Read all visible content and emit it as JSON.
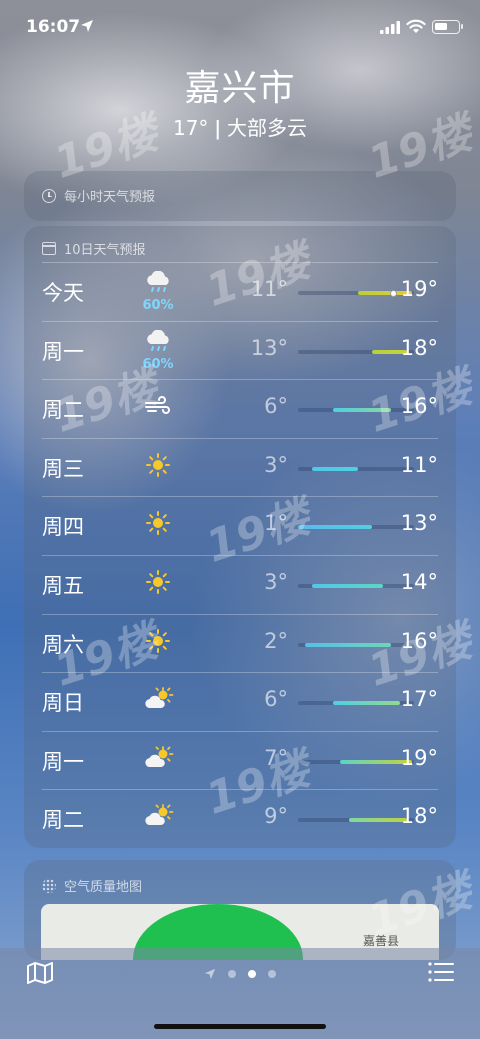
{
  "status_bar": {
    "time": "16:07"
  },
  "header": {
    "city": "嘉兴市",
    "summary": "17° ǀ 大部多云"
  },
  "hourly": {
    "title": "每小时天气预报"
  },
  "daily": {
    "title": "10日天气预报",
    "days": [
      {
        "day": "今天",
        "icon": "rain-cloud-icon",
        "precip": "60%",
        "lo": "11°",
        "hi": "19°",
        "range": [
          0.52,
          0.98
        ],
        "current": 0.82,
        "colors": [
          "#b8cf3a",
          "#e7c93a"
        ]
      },
      {
        "day": "周一",
        "icon": "rain-cloud-icon",
        "precip": "60%",
        "lo": "13°",
        "hi": "18°",
        "range": [
          0.64,
          0.94
        ],
        "current": null,
        "colors": [
          "#b6d13e",
          "#c9d23a"
        ]
      },
      {
        "day": "周二",
        "icon": "wind-icon",
        "precip": "",
        "lo": "6°",
        "hi": "16°",
        "range": [
          0.3,
          0.8
        ],
        "current": null,
        "colors": [
          "#4fd0e0",
          "#8bd69a"
        ]
      },
      {
        "day": "周三",
        "icon": "sun-icon",
        "precip": "",
        "lo": "3°",
        "hi": "11°",
        "range": [
          0.12,
          0.52
        ],
        "current": null,
        "colors": [
          "#53c6e8",
          "#4fd0e0"
        ]
      },
      {
        "day": "周四",
        "icon": "sun-icon",
        "precip": "",
        "lo": "1°",
        "hi": "13°",
        "range": [
          0.0,
          0.64
        ],
        "current": null,
        "colors": [
          "#5bb9ee",
          "#4fd0e0"
        ]
      },
      {
        "day": "周五",
        "icon": "sun-icon",
        "precip": "",
        "lo": "3°",
        "hi": "14°",
        "range": [
          0.12,
          0.73
        ],
        "current": null,
        "colors": [
          "#53c6e8",
          "#5cd6c4"
        ]
      },
      {
        "day": "周六",
        "icon": "sun-icon",
        "precip": "",
        "lo": "2°",
        "hi": "16°",
        "range": [
          0.06,
          0.8
        ],
        "current": null,
        "colors": [
          "#57bfe8",
          "#6cd6b8"
        ]
      },
      {
        "day": "周日",
        "icon": "partly-sunny-icon",
        "precip": "",
        "lo": "6°",
        "hi": "17°",
        "range": [
          0.3,
          0.88
        ],
        "current": null,
        "colors": [
          "#4fd0e0",
          "#92d892"
        ]
      },
      {
        "day": "周一",
        "icon": "partly-sunny-icon",
        "precip": "",
        "lo": "7°",
        "hi": "19°",
        "range": [
          0.36,
          0.98
        ],
        "current": null,
        "colors": [
          "#5ad4c6",
          "#c8d23a"
        ]
      },
      {
        "day": "周二",
        "icon": "partly-sunny-icon",
        "precip": "",
        "lo": "9°",
        "hi": "18°",
        "range": [
          0.44,
          0.94
        ],
        "current": null,
        "colors": [
          "#7fd6a6",
          "#c0d43c"
        ]
      }
    ]
  },
  "air_quality": {
    "title": "空气质量地图",
    "map_label": "嘉善县"
  },
  "watermark": "19楼"
}
